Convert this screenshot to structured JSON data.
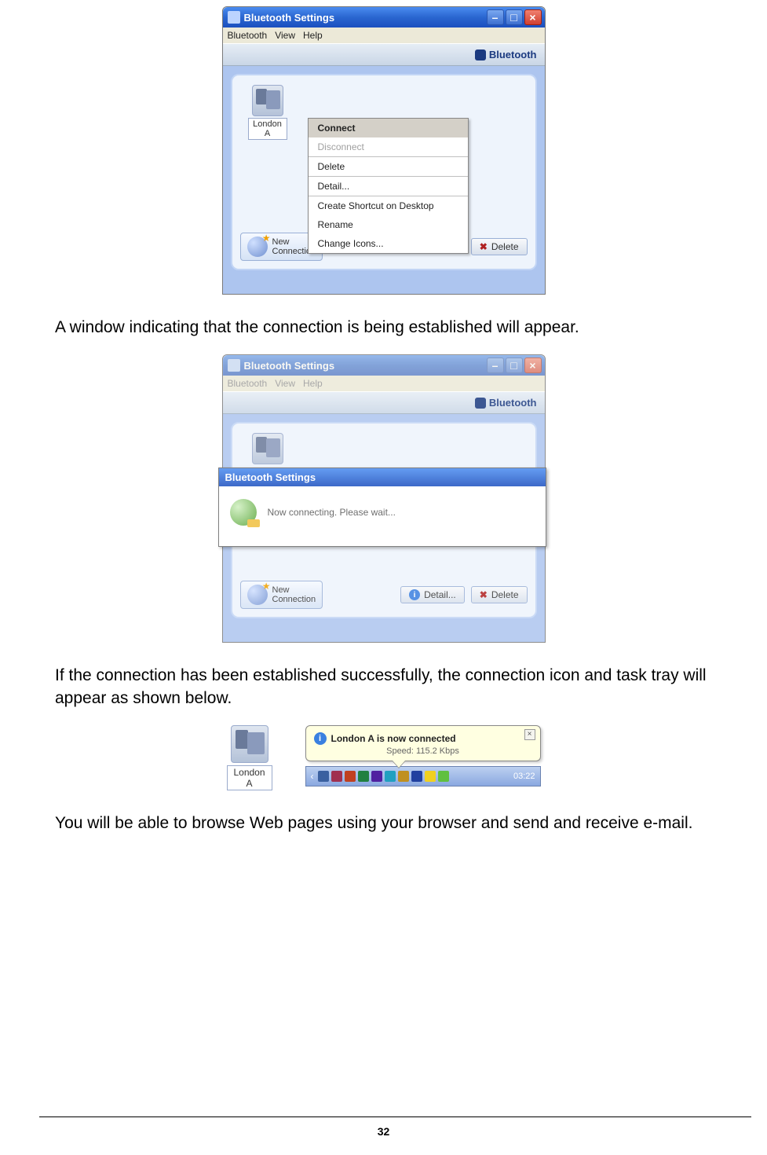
{
  "page_number": "32",
  "paragraphs": {
    "p1": "A window indicating that the connection is being established will appear.",
    "p2": "If the connection has been established successfully, the connection icon and task tray will appear as shown below.",
    "p3": "You will be able to browse Web pages using your browser and send and receive e-mail."
  },
  "window_common": {
    "title": "Bluetooth Settings",
    "menu": {
      "m1": "Bluetooth",
      "m2": "View",
      "m3": "Help"
    },
    "brand": "Bluetooth",
    "device_label": "London A",
    "btn_new_connection": "New\nConnection",
    "btn_detail": "Detail...",
    "btn_delete": "Delete"
  },
  "context_menu": {
    "connect": "Connect",
    "disconnect": "Disconnect",
    "delete": "Delete",
    "detail": "Detail...",
    "shortcut": "Create Shortcut on Desktop",
    "rename": "Rename",
    "change_icons": "Change Icons..."
  },
  "popup": {
    "title": "Bluetooth Settings",
    "message": "Now connecting. Please wait..."
  },
  "tray": {
    "device_label": "London A",
    "balloon_title": "London A is now connected",
    "balloon_speed": "Speed: 115.2 Kbps",
    "clock": "03:22"
  }
}
